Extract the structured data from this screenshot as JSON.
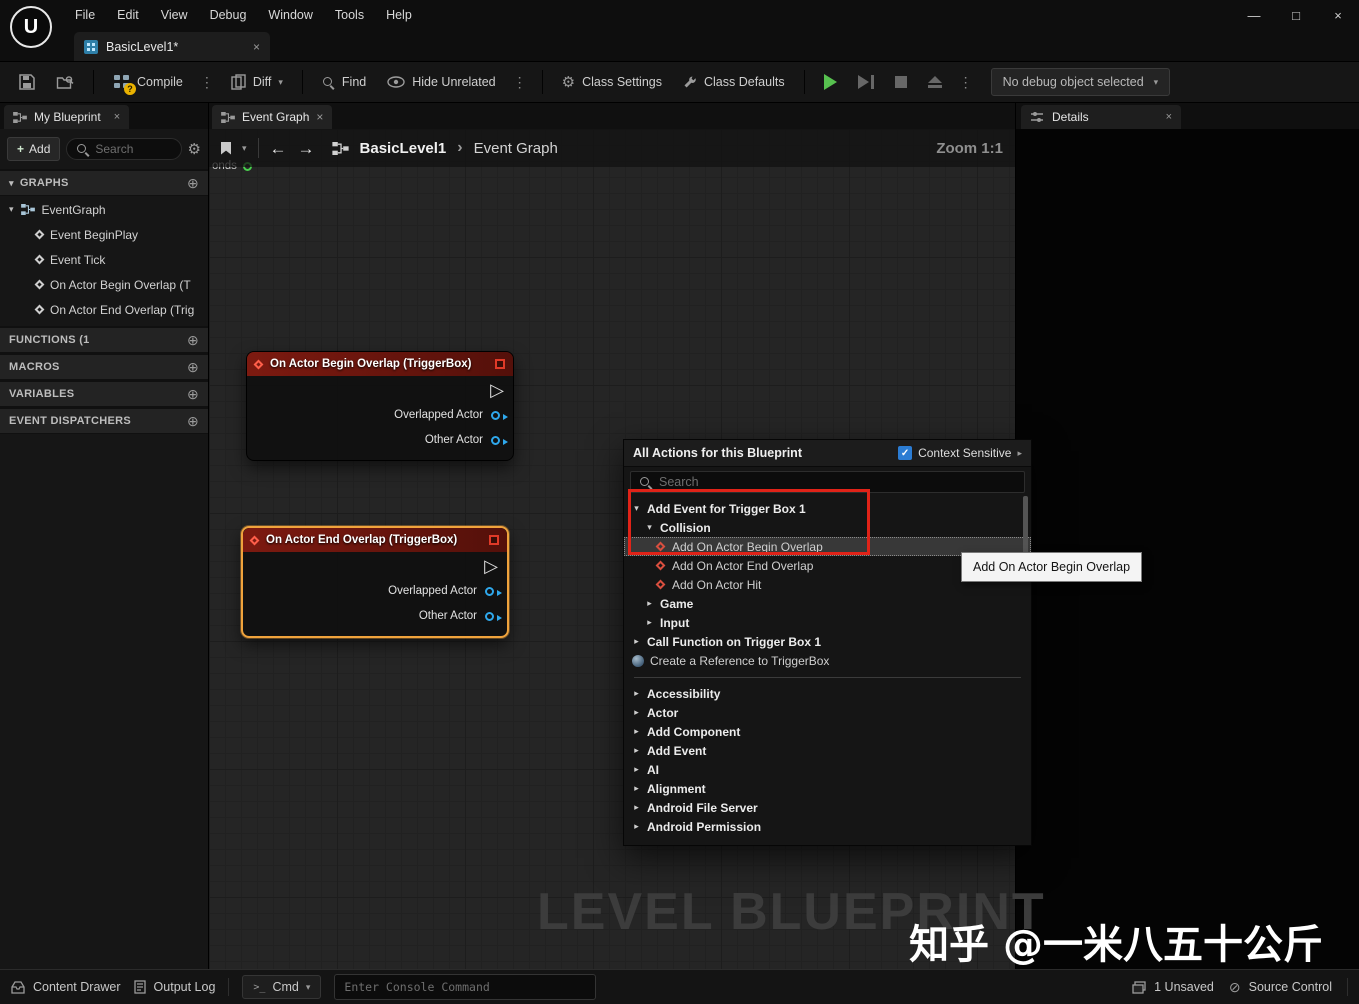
{
  "menu": {
    "items": [
      "File",
      "Edit",
      "View",
      "Debug",
      "Window",
      "Tools",
      "Help"
    ]
  },
  "window": {
    "doc_tab": "BasicLevel1*",
    "logo_letter": "U"
  },
  "icons": {
    "gear": "⚙",
    "plus_circle": "⊕",
    "close": "×",
    "caret_down": "▾",
    "caret_right": "▸",
    "chevron_down": "▾",
    "breadcrumb_sep": "›",
    "kebab": "⋮",
    "back": "←",
    "forward": "→",
    "check": "✓",
    "slash_circle": "⊘",
    "minimize": "—",
    "maximize": "□",
    "plus": "+",
    "exec_pin": "▷",
    "prompt": "&gt;_"
  },
  "toolbar": {
    "compile": "Compile",
    "diff": "Diff",
    "find": "Find",
    "hide_unrelated": "Hide Unrelated",
    "class_settings": "Class Settings",
    "class_defaults": "Class Defaults",
    "debug_dropdown": "No debug object selected",
    "compile_badge": "?"
  },
  "my_blueprint": {
    "title": "My Blueprint",
    "add_label": "Add",
    "search_placeholder": "Search",
    "sections": [
      "GRAPHS",
      "FUNCTIONS (1",
      "MACROS",
      "VARIABLES",
      "EVENT DISPATCHERS"
    ],
    "graph_root": "EventGraph",
    "events": [
      "Event BeginPlay",
      "Event Tick",
      "On Actor Begin Overlap (T",
      "On Actor End Overlap (Trig"
    ]
  },
  "graph": {
    "tab_label": "Event Graph",
    "breadcrumb_root": "BasicLevel1",
    "breadcrumb_page": "Event Graph",
    "zoom_label": "Zoom 1:1",
    "watermark": "LEVEL BLUEPRINT",
    "fragment_label": "onds"
  },
  "nodes": [
    {
      "title": "On Actor Begin Overlap (TriggerBox)",
      "pins": [
        "Overlapped Actor",
        "Other Actor"
      ]
    },
    {
      "title": "On Actor End Overlap (TriggerBox)",
      "pins": [
        "Overlapped Actor",
        "Other Actor"
      ]
    }
  ],
  "popup": {
    "title": "All Actions for this Blueprint",
    "context_sensitive_label": "Context Sensitive",
    "search_placeholder": "Search",
    "rows": [
      "Add Event for Trigger Box 1",
      "Collision",
      "Add On Actor Begin Overlap",
      "Add On Actor End Overlap",
      "Add On Actor Hit",
      "Game",
      "Input",
      "Call Function on Trigger Box 1",
      "Create a Reference to TriggerBox",
      "Accessibility",
      "Actor",
      "Add Component",
      "Add Event",
      "AI",
      "Alignment",
      "Android File Server",
      "Android Permission"
    ]
  },
  "tooltip": {
    "text": "Add On Actor Begin Overlap"
  },
  "details": {
    "title": "Details"
  },
  "status_bar": {
    "content_drawer": "Content Drawer",
    "output_log": "Output Log",
    "cmd_label": "Cmd",
    "console_placeholder": "Enter Console Command",
    "unsaved_label": "1 Unsaved",
    "source_control_label": "Source Control"
  },
  "watermark": {
    "zhihu": "知乎 @一米八五十公斤"
  }
}
